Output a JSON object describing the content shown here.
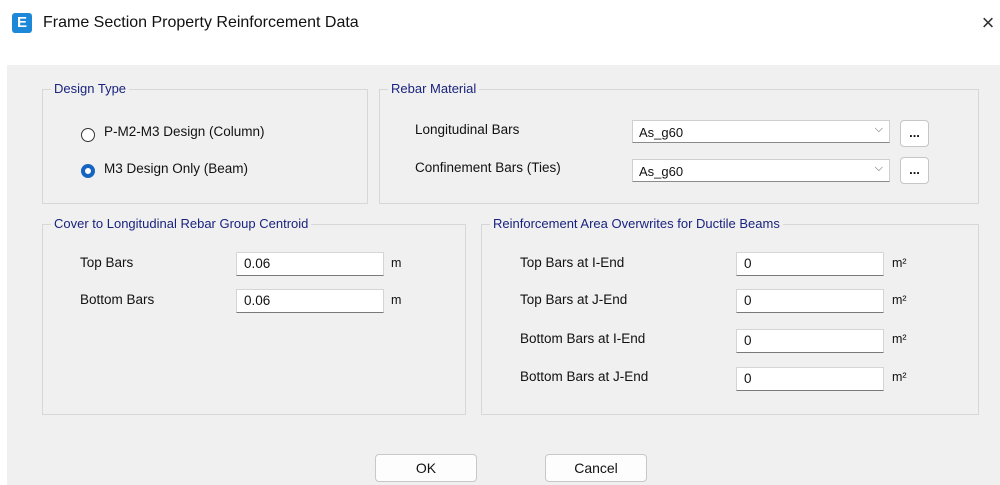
{
  "window": {
    "app_icon_letter": "E",
    "title": "Frame Section Property Reinforcement Data",
    "close_glyph": "×"
  },
  "design_type": {
    "group_label": "Design Type",
    "options": [
      {
        "label": "P-M2-M3 Design  (Column)",
        "checked": false
      },
      {
        "label": "M3 Design Only  (Beam)",
        "checked": true
      }
    ]
  },
  "rebar_material": {
    "group_label": "Rebar Material",
    "longitudinal": {
      "label": "Longitudinal Bars",
      "value": "As_g60",
      "button": "..."
    },
    "confinement": {
      "label": "Confinement Bars (Ties)",
      "value": "As_g60",
      "button": "..."
    }
  },
  "cover": {
    "group_label": "Cover to Longitudinal Rebar Group Centroid",
    "rows": [
      {
        "label": "Top Bars",
        "value": "0.06",
        "unit": "m"
      },
      {
        "label": "Bottom  Bars",
        "value": "0.06",
        "unit": "m"
      }
    ]
  },
  "overwrites": {
    "group_label": "Reinforcement Area Overwrites for Ductile Beams",
    "rows": [
      {
        "label": "Top Bars at I-End",
        "value": "0",
        "unit": "m²"
      },
      {
        "label": "Top Bars at J-End",
        "value": "0",
        "unit": "m²"
      },
      {
        "label": "Bottom Bars at I-End",
        "value": "0",
        "unit": "m²"
      },
      {
        "label": "Bottom Bars at J-End",
        "value": "0",
        "unit": "m²"
      }
    ]
  },
  "buttons": {
    "ok": "OK",
    "cancel": "Cancel"
  },
  "colors": {
    "accent": "#1565c0",
    "group_label": "#1a237e",
    "dialog_background": "#f0f0f0",
    "app_icon": "#1e88d8"
  },
  "icons": {
    "app": "etabs-app-icon",
    "close": "close-icon",
    "dropdown": "chevron-down-icon"
  }
}
